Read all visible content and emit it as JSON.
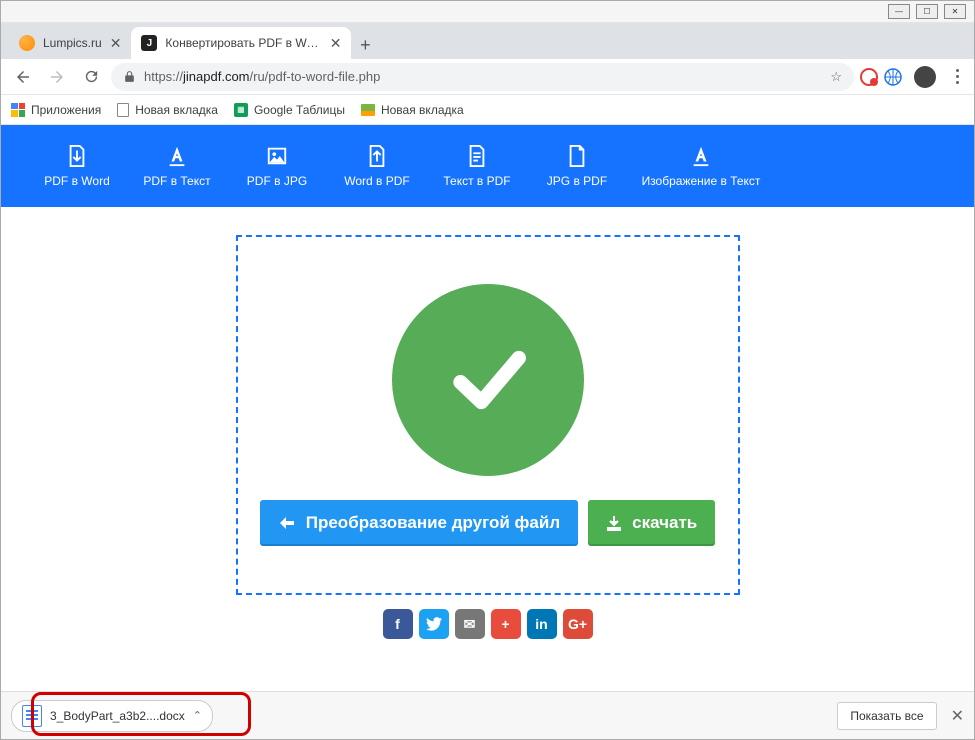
{
  "window": {
    "min": "—",
    "max": "☐",
    "close": "✕"
  },
  "tabs": [
    {
      "title": "Lumpics.ru",
      "favicon": "orange"
    },
    {
      "title": "Конвертировать PDF в Word - P",
      "favicon": "J",
      "active": true
    }
  ],
  "address": {
    "protocol": "https://",
    "host": "jinapdf.com",
    "path": "/ru/pdf-to-word-file.php"
  },
  "bookmarks": {
    "apps": "Приложения",
    "items": [
      "Новая вкладка",
      "Google Таблицы",
      "Новая вкладка"
    ]
  },
  "toolbar": {
    "items": [
      {
        "label": "PDF в Word",
        "icon": "page-out"
      },
      {
        "label": "PDF в Текст",
        "icon": "text-underline"
      },
      {
        "label": "PDF в JPG",
        "icon": "image"
      },
      {
        "label": "Word в PDF",
        "icon": "page-in"
      },
      {
        "label": "Текст в PDF",
        "icon": "page-lines"
      },
      {
        "label": "JPG в PDF",
        "icon": "page-fold"
      },
      {
        "label": "Изображение в Текст",
        "icon": "text-underline"
      }
    ]
  },
  "main": {
    "convert_another": "Преобразование другой файл",
    "download": "скачать"
  },
  "social": [
    "f",
    "t",
    "✉",
    "+",
    "in",
    "G+"
  ],
  "download_bar": {
    "filename": "3_BodyPart_a3b2....docx",
    "show_all": "Показать все"
  }
}
